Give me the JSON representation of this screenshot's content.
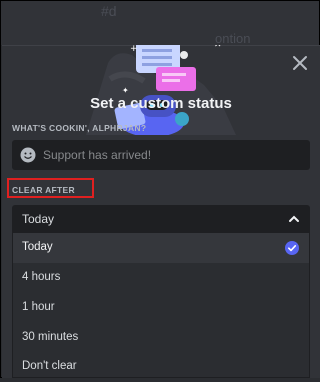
{
  "background": {
    "ghost_top": "#d",
    "ghost_right": "ontion"
  },
  "modal": {
    "title": "Set a custom status",
    "status_label": "WHAT'S COOKIN', ALPHRJAN?",
    "status_placeholder": "Support has arrived!",
    "clear_after_label": "CLEAR AFTER",
    "dropdown_value": "Today",
    "options": [
      {
        "label": "Today",
        "selected": true
      },
      {
        "label": "4 hours",
        "selected": false
      },
      {
        "label": "1 hour",
        "selected": false
      },
      {
        "label": "30 minutes",
        "selected": false
      },
      {
        "label": "Don't clear",
        "selected": false
      }
    ]
  },
  "colors": {
    "accent": "#5865f2",
    "highlight": "#e02020",
    "panel": "#313338",
    "input": "#1e1f22"
  },
  "icons": [
    "close-icon",
    "emoji-icon",
    "chevron-up-icon",
    "checkmark-icon"
  ]
}
